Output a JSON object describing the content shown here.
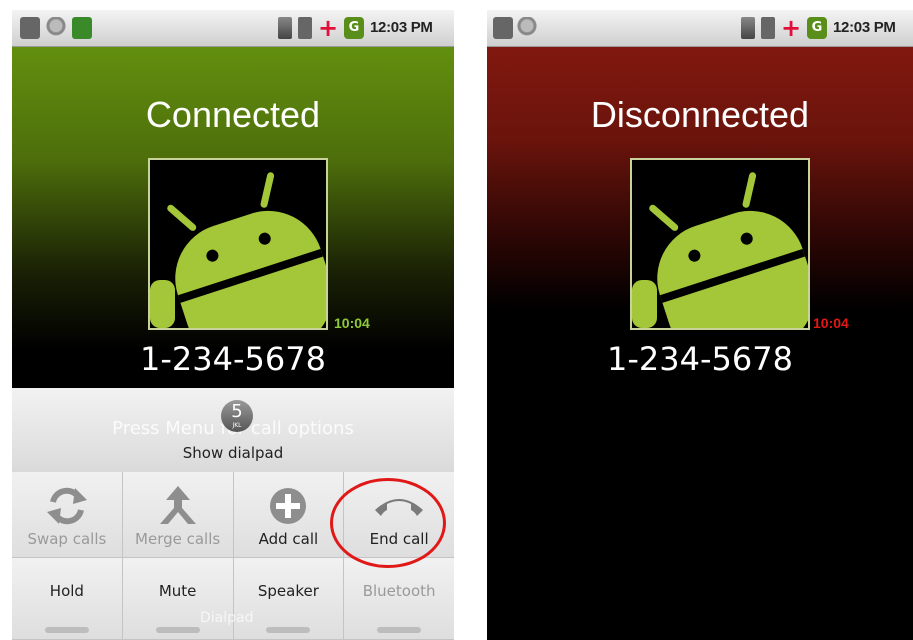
{
  "left_screen": {
    "status_time": "12:03 PM",
    "state": "Connected",
    "timer": "10:04",
    "number": "1-234-5678",
    "dialpad_hint": "Press Menu for call options",
    "dial_key": "5",
    "dial_key_sub": "JKL",
    "show_dialpad": "Show dialpad",
    "buttons_row1": [
      "Swap calls",
      "Merge calls",
      "Add call",
      "End call"
    ],
    "buttons_row2": [
      "Hold",
      "Mute",
      "Speaker",
      "Bluetooth"
    ],
    "ghost_text": "Dialpad"
  },
  "right_screen": {
    "status_time": "12:03 PM",
    "state": "Disconnected",
    "timer": "10:04",
    "number": "1-234-5678"
  },
  "colors": {
    "connected": "#5f8a10",
    "disconnected": "#8a1a10",
    "timer_green": "#8fc93a",
    "timer_red": "#e01818",
    "android_green": "#a4c639",
    "highlight": "#e01818"
  },
  "icons": [
    "usb-icon",
    "debug-icon",
    "call-icon",
    "sim-icon",
    "battery-icon",
    "plus-icon",
    "wifi-icon",
    "swap-icon",
    "merge-icon",
    "add-icon",
    "end-call-icon"
  ]
}
